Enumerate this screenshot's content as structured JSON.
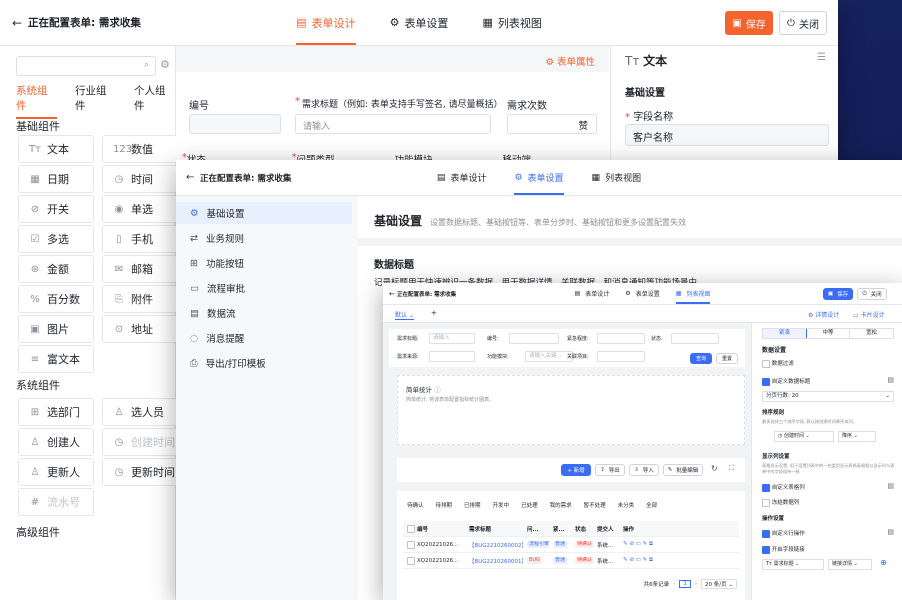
{
  "win1": {
    "title": "正在配置表单: 需求收集",
    "tabs": [
      "表单设计",
      "表单设置",
      "列表视图"
    ],
    "save": "保存",
    "close": "关闭",
    "lib_tabs": [
      "系统组件",
      "行业组件",
      "个人组件"
    ],
    "basic_title": "基础组件",
    "basic": [
      [
        "文本",
        "数值"
      ],
      [
        "日期",
        "时间"
      ],
      [
        "开关",
        "单选"
      ],
      [
        "多选",
        "手机"
      ],
      [
        "金额",
        "邮箱"
      ],
      [
        "百分数",
        "附件"
      ],
      [
        "图片",
        "地址"
      ],
      [
        "富文本",
        ""
      ]
    ],
    "system_title": "系统组件",
    "system": [
      [
        "选部门",
        "选人员"
      ],
      [
        "创建人",
        "创建时间"
      ],
      [
        "更新人",
        "更新时间"
      ],
      [
        "流水号",
        ""
      ]
    ],
    "advanced_title": "高级组件",
    "form_props": "表单属性",
    "f_no": "编号",
    "f_title": "需求标题（例如: 表单支持手写签名, 请尽量概括）",
    "f_count": "需求次数",
    "f_title_ph": "请输入",
    "like": "赞",
    "f_row2": [
      "状态",
      "问题类型",
      "功能模块",
      "移动端"
    ],
    "prop_title": "文本",
    "prop_basic": "基础设置",
    "prop_field": "字段名称",
    "prop_field_value": "客户名称"
  },
  "win2": {
    "title": "正在配置表单: 需求收集",
    "tabs": [
      "表单设计",
      "表单设置",
      "列表视图"
    ],
    "nav": [
      "基础设置",
      "业务规则",
      "功能按钮",
      "流程审批",
      "数据流",
      "消息提醒",
      "导出/打印模板"
    ],
    "heading": "基础设置",
    "heading_desc": "设置数据标题、基础按钮等、表单分步时、基础按钮和更多设置配置失效",
    "data_title": "数据标题",
    "data_title_desc": "记录标题用于快速辨识一条数据。用于数据详情、关联数据、和消息通知等功能场景中。"
  },
  "win3": {
    "title": "正在配置表单: 需求收集",
    "tabs": [
      "表单设计",
      "表单设置",
      "列表视图"
    ],
    "save": "保存",
    "close": "关闭",
    "view": "默认",
    "plus": "+",
    "detail": "详情设计",
    "card": "卡片设计",
    "filters": [
      {
        "label": "需求标题:",
        "ph": "请输入"
      },
      {
        "label": "编号:",
        "ph": ""
      },
      {
        "label": "紧急程度:",
        "ph": ""
      },
      {
        "label": "状态:",
        "ph": ""
      },
      {
        "label": "需求来源:",
        "ph": ""
      },
      {
        "label": "功能模块:",
        "ph": "请输入关键..."
      },
      {
        "label": "关联项目:",
        "ph": ""
      }
    ],
    "query": "查询",
    "reset": "重置",
    "stat_title": "简单统计",
    "stat_desc": "简单统计, 将该表单配置指标统计图表。",
    "actions": [
      "+ 新增",
      "导出",
      "导入",
      "批量编辑"
    ],
    "status_tabs": [
      "待确认",
      "待排期",
      "已排期",
      "开发中",
      "已处理",
      "我的需求",
      "暂不处理",
      "未分类",
      "全部"
    ],
    "cols": [
      "编号",
      "需求标题",
      "问...",
      "紧...",
      "状态",
      "提交人",
      "操作"
    ],
    "rows": [
      {
        "no": "XQ20221026...",
        "title": "【BUG2210260002】表单...",
        "q": "流程引擎",
        "u": "普通",
        "s": "待确认",
        "by": "系统..."
      },
      {
        "no": "XQ20221026...",
        "title": "【BUG2210260001】设置...",
        "q": "BUG",
        "u": "普通",
        "s": "待确认",
        "by": "系统..."
      }
    ],
    "total": "共6条记录",
    "page": "1",
    "per": "20 条/页",
    "side_tabs": [
      "紧凑",
      "中等",
      "宽松"
    ],
    "data_settings": "数据设置",
    "data_filter": "数据过滤",
    "custom_title": "自定义数据标题",
    "page_rows_label": "分页行数:",
    "page_rows": "20",
    "sort_settings": "排序规则",
    "sort_desc": "最多选择三个排序字段, 默认按创建时间降序排列。",
    "sort_field": "创建时间",
    "sort_order": "降序",
    "display_settings": "显示列设置",
    "display_desc": "表格显示设置, 用于设置列表中的一些类型显示表格高根据以显示列与表单中的字段保持一致",
    "custom_cols": "自定义表格列",
    "freeze": "冻结数据列",
    "op_settings": "操作设置",
    "custom_op": "自定义行操作",
    "field_link": "开启字段链接",
    "link_field": "需求标题",
    "link_target": "链接详情"
  }
}
